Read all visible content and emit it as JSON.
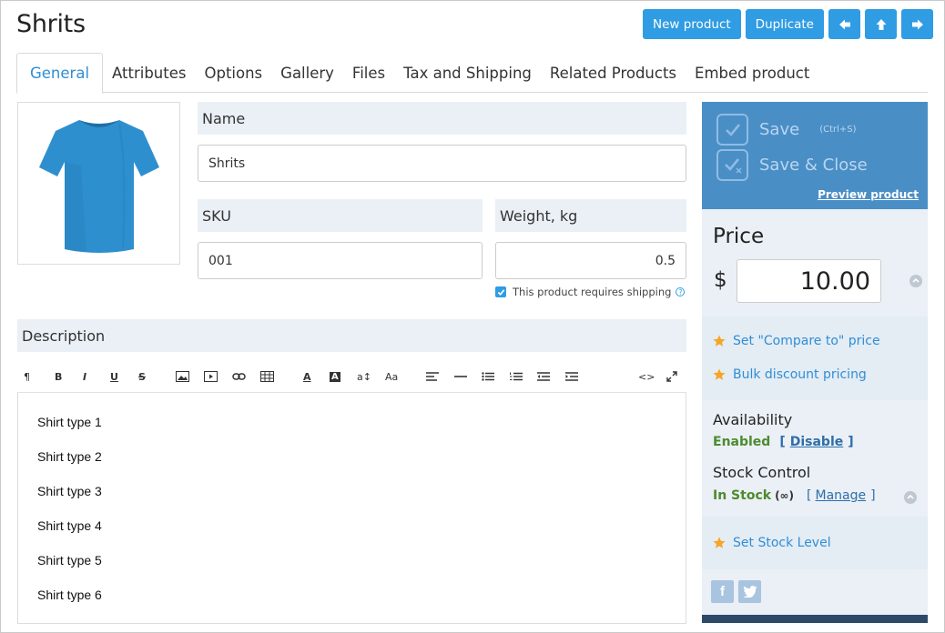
{
  "page": {
    "title": "Shrits"
  },
  "top_actions": {
    "new_product": "New product",
    "duplicate": "Duplicate",
    "arrows": [
      "arrow-left-icon",
      "arrow-up-icon",
      "arrow-right-icon"
    ]
  },
  "tabs": [
    {
      "label": "General",
      "active": true
    },
    {
      "label": "Attributes"
    },
    {
      "label": "Options"
    },
    {
      "label": "Gallery"
    },
    {
      "label": "Files"
    },
    {
      "label": "Tax and Shipping"
    },
    {
      "label": "Related Products"
    },
    {
      "label": "Embed product"
    }
  ],
  "product_image": {
    "icon": "tshirt-image",
    "color": "#2e8fcf"
  },
  "form": {
    "name_label": "Name",
    "name_value": "Shrits",
    "sku_label": "SKU",
    "sku_value": "001",
    "weight_label": "Weight, kg",
    "weight_value": "0.5",
    "shipping_label": "This product requires shipping",
    "shipping_checked": true
  },
  "description": {
    "label": "Description",
    "toolbar": [
      "paragraph-icon",
      "bold-icon",
      "italic-icon",
      "underline-icon",
      "strikethrough-icon",
      "image-icon",
      "video-icon",
      "link-icon",
      "table-icon",
      "font-color-icon",
      "background-color-icon",
      "font-size-icon",
      "font-family-icon",
      "align-icon",
      "horizontal-rule-icon",
      "unordered-list-icon",
      "ordered-list-icon",
      "outdent-icon",
      "indent-icon",
      "code-view-icon",
      "fullscreen-icon"
    ],
    "lines": [
      "Shirt type 1",
      "Shirt type 2",
      "Shirt type 3",
      "Shirt type 4",
      "Shirt type 5",
      "Shirt type 6"
    ]
  },
  "sidebar": {
    "save_label": "Save",
    "save_hint": "(Ctrl+S)",
    "save_close_label": "Save & Close",
    "preview_label": "Preview product",
    "price_label": "Price",
    "currency": "$",
    "price_value": "10.00",
    "compare_link": "Set \"Compare to\" price",
    "bulk_link": "Bulk discount pricing",
    "availability_label": "Availability",
    "availability_status": "Enabled",
    "availability_action": "Disable",
    "bracket_open": "[",
    "bracket_close": "]",
    "stock_label": "Stock Control",
    "stock_status": "In Stock",
    "stock_qty": "(∞)",
    "stock_action": "Manage",
    "stock_level_link": "Set Stock Level",
    "social": [
      {
        "label": "f",
        "icon": "facebook-icon"
      },
      {
        "label": "",
        "icon": "twitter-icon"
      }
    ]
  },
  "colors": {
    "accent": "#2f9ce3",
    "save_panel": "#4a8ec6",
    "panel_bg": "#eaf0f6",
    "enabled_green": "#4e8a2e",
    "star": "#f5a623"
  }
}
